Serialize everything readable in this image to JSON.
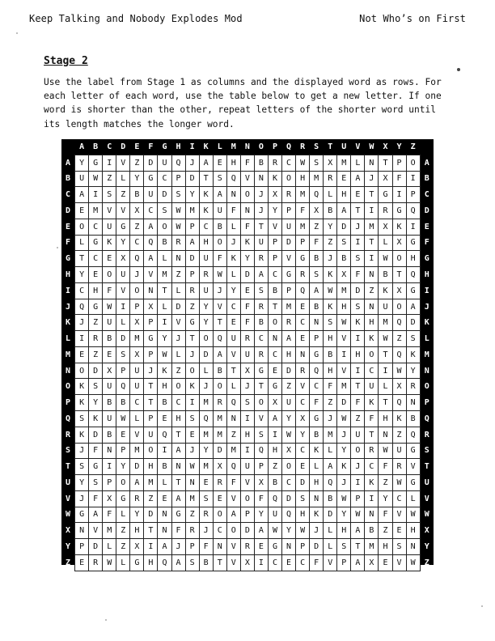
{
  "header": {
    "left": "Keep Talking and Nobody Explodes Mod",
    "right": "Not Who’s on First"
  },
  "stage_title": "Stage 2",
  "instructions": "Use the label from Stage 1 as columns and the displayed word as rows. For each letter of each word, use the table below to get a new letter. If one word is shorter than the other, repeat letters of the shorter word until its length matches the longer word.",
  "table": {
    "columns": [
      "A",
      "B",
      "C",
      "D",
      "E",
      "F",
      "G",
      "H",
      "I",
      "K",
      "L",
      "M",
      "N",
      "O",
      "P",
      "Q",
      "R",
      "S",
      "T",
      "U",
      "V",
      "W",
      "X",
      "Y",
      "Z"
    ],
    "rows": [
      {
        "label": "A",
        "cells": [
          "Y",
          "G",
          "I",
          "V",
          "Z",
          "D",
          "U",
          "Q",
          "J",
          "A",
          "E",
          "H",
          "F",
          "B",
          "R",
          "C",
          "W",
          "S",
          "X",
          "M",
          "L",
          "N",
          "T",
          "P",
          "O"
        ]
      },
      {
        "label": "B",
        "cells": [
          "U",
          "W",
          "Z",
          "L",
          "Y",
          "G",
          "C",
          "P",
          "D",
          "T",
          "S",
          "Q",
          "V",
          "N",
          "K",
          "O",
          "H",
          "M",
          "R",
          "E",
          "A",
          "J",
          "X",
          "F",
          "I"
        ]
      },
      {
        "label": "C",
        "cells": [
          "A",
          "I",
          "S",
          "Z",
          "B",
          "U",
          "D",
          "S",
          "Y",
          "K",
          "A",
          "N",
          "O",
          "J",
          "X",
          "R",
          "M",
          "Q",
          "L",
          "H",
          "E",
          "T",
          "G",
          "I",
          "P"
        ]
      },
      {
        "label": "D",
        "cells": [
          "E",
          "M",
          "V",
          "V",
          "X",
          "C",
          "S",
          "W",
          "M",
          "K",
          "U",
          "F",
          "N",
          "J",
          "Y",
          "P",
          "F",
          "X",
          "B",
          "A",
          "T",
          "I",
          "R",
          "G",
          "Q"
        ]
      },
      {
        "label": "E",
        "cells": [
          "O",
          "C",
          "U",
          "G",
          "Z",
          "A",
          "O",
          "W",
          "P",
          "C",
          "B",
          "L",
          "F",
          "T",
          "V",
          "U",
          "M",
          "Z",
          "Y",
          "D",
          "J",
          "M",
          "X",
          "K",
          "I"
        ]
      },
      {
        "label": "F",
        "cells": [
          "L",
          "G",
          "K",
          "Y",
          "C",
          "Q",
          "B",
          "R",
          "A",
          "H",
          "O",
          "J",
          "K",
          "U",
          "P",
          "D",
          "P",
          "F",
          "Z",
          "S",
          "I",
          "T",
          "L",
          "X",
          "G"
        ]
      },
      {
        "label": "G",
        "cells": [
          "T",
          "C",
          "E",
          "X",
          "Q",
          "A",
          "L",
          "N",
          "D",
          "U",
          "F",
          "K",
          "Y",
          "R",
          "P",
          "V",
          "G",
          "B",
          "J",
          "B",
          "S",
          "I",
          "W",
          "O",
          "H"
        ]
      },
      {
        "label": "H",
        "cells": [
          "Y",
          "E",
          "O",
          "U",
          "J",
          "V",
          "M",
          "Z",
          "P",
          "R",
          "W",
          "L",
          "D",
          "A",
          "C",
          "G",
          "R",
          "S",
          "K",
          "X",
          "F",
          "N",
          "B",
          "T",
          "Q"
        ]
      },
      {
        "label": "I",
        "cells": [
          "C",
          "H",
          "F",
          "V",
          "O",
          "N",
          "T",
          "L",
          "R",
          "U",
          "J",
          "Y",
          "E",
          "S",
          "B",
          "P",
          "Q",
          "A",
          "W",
          "M",
          "D",
          "Z",
          "K",
          "X",
          "G"
        ]
      },
      {
        "label": "J",
        "cells": [
          "Q",
          "G",
          "W",
          "I",
          "P",
          "X",
          "L",
          "D",
          "Z",
          "Y",
          "V",
          "C",
          "F",
          "R",
          "T",
          "M",
          "E",
          "B",
          "K",
          "H",
          "S",
          "N",
          "U",
          "O",
          "A"
        ]
      },
      {
        "label": "K",
        "cells": [
          "J",
          "Z",
          "U",
          "L",
          "X",
          "P",
          "I",
          "V",
          "G",
          "Y",
          "T",
          "E",
          "F",
          "B",
          "O",
          "R",
          "C",
          "N",
          "S",
          "W",
          "K",
          "H",
          "M",
          "Q",
          "D"
        ]
      },
      {
        "label": "L",
        "cells": [
          "I",
          "R",
          "B",
          "D",
          "M",
          "G",
          "Y",
          "J",
          "T",
          "O",
          "Q",
          "U",
          "R",
          "C",
          "N",
          "A",
          "E",
          "P",
          "H",
          "V",
          "I",
          "K",
          "W",
          "Z",
          "S"
        ]
      },
      {
        "label": "M",
        "cells": [
          "E",
          "Z",
          "E",
          "S",
          "X",
          "P",
          "W",
          "L",
          "J",
          "D",
          "A",
          "V",
          "U",
          "R",
          "C",
          "H",
          "N",
          "G",
          "B",
          "I",
          "H",
          "O",
          "T",
          "Q",
          "K"
        ]
      },
      {
        "label": "N",
        "cells": [
          "O",
          "D",
          "X",
          "P",
          "U",
          "J",
          "K",
          "Z",
          "O",
          "L",
          "B",
          "T",
          "X",
          "G",
          "E",
          "D",
          "R",
          "Q",
          "H",
          "V",
          "I",
          "C",
          "I",
          "W",
          "Y"
        ]
      },
      {
        "label": "O",
        "cells": [
          "K",
          "S",
          "U",
          "Q",
          "U",
          "T",
          "H",
          "O",
          "K",
          "J",
          "O",
          "L",
          "J",
          "T",
          "G",
          "Z",
          "V",
          "C",
          "F",
          "M",
          "T",
          "U",
          "L",
          "X",
          "R"
        ]
      },
      {
        "label": "P",
        "cells": [
          "K",
          "Y",
          "B",
          "B",
          "C",
          "T",
          "B",
          "C",
          "I",
          "M",
          "R",
          "Q",
          "S",
          "O",
          "X",
          "U",
          "C",
          "F",
          "Z",
          "D",
          "F",
          "K",
          "T",
          "Q",
          "N"
        ]
      },
      {
        "label": "Q",
        "cells": [
          "S",
          "K",
          "U",
          "W",
          "L",
          "P",
          "E",
          "H",
          "S",
          "Q",
          "M",
          "N",
          "I",
          "V",
          "A",
          "Y",
          "X",
          "G",
          "J",
          "W",
          "Z",
          "F",
          "H",
          "K",
          "B"
        ]
      },
      {
        "label": "R",
        "cells": [
          "K",
          "D",
          "B",
          "E",
          "V",
          "U",
          "Q",
          "T",
          "E",
          "M",
          "M",
          "Z",
          "H",
          "S",
          "I",
          "W",
          "Y",
          "B",
          "M",
          "J",
          "U",
          "T",
          "N",
          "Z",
          "Q"
        ]
      },
      {
        "label": "S",
        "cells": [
          "J",
          "F",
          "N",
          "P",
          "M",
          "O",
          "I",
          "A",
          "J",
          "Y",
          "D",
          "M",
          "I",
          "Q",
          "H",
          "X",
          "C",
          "K",
          "L",
          "Y",
          "O",
          "R",
          "W",
          "U",
          "G"
        ]
      },
      {
        "label": "T",
        "cells": [
          "S",
          "G",
          "I",
          "Y",
          "D",
          "H",
          "B",
          "N",
          "W",
          "M",
          "X",
          "Q",
          "U",
          "P",
          "Z",
          "O",
          "E",
          "L",
          "A",
          "K",
          "J",
          "C",
          "F",
          "R",
          "V"
        ]
      },
      {
        "label": "U",
        "cells": [
          "Y",
          "S",
          "P",
          "O",
          "A",
          "M",
          "L",
          "T",
          "N",
          "E",
          "R",
          "F",
          "V",
          "X",
          "B",
          "C",
          "D",
          "H",
          "Q",
          "J",
          "I",
          "K",
          "Z",
          "W",
          "G"
        ]
      },
      {
        "label": "V",
        "cells": [
          "J",
          "F",
          "X",
          "G",
          "R",
          "Z",
          "E",
          "A",
          "M",
          "S",
          "E",
          "V",
          "O",
          "F",
          "Q",
          "D",
          "S",
          "N",
          "B",
          "W",
          "P",
          "I",
          "Y",
          "C",
          "L"
        ]
      },
      {
        "label": "W",
        "cells": [
          "G",
          "A",
          "F",
          "L",
          "Y",
          "D",
          "N",
          "G",
          "Z",
          "R",
          "O",
          "A",
          "P",
          "Y",
          "U",
          "Q",
          "H",
          "K",
          "D",
          "Y",
          "W",
          "N",
          "F",
          "V",
          "W"
        ]
      },
      {
        "label": "X",
        "cells": [
          "N",
          "V",
          "M",
          "Z",
          "H",
          "T",
          "N",
          "F",
          "R",
          "J",
          "C",
          "O",
          "D",
          "A",
          "W",
          "Y",
          "W",
          "J",
          "L",
          "H",
          "A",
          "B",
          "Z",
          "E",
          "H"
        ]
      },
      {
        "label": "Y",
        "cells": [
          "P",
          "D",
          "L",
          "Z",
          "X",
          "I",
          "A",
          "J",
          "P",
          "F",
          "N",
          "V",
          "R",
          "E",
          "G",
          "N",
          "P",
          "D",
          "L",
          "S",
          "T",
          "M",
          "H",
          "S",
          "N"
        ]
      },
      {
        "label": "Z",
        "cells": [
          "E",
          "R",
          "W",
          "L",
          "G",
          "H",
          "Q",
          "A",
          "S",
          "B",
          "T",
          "V",
          "X",
          "I",
          "C",
          "E",
          "C",
          "F",
          "V",
          "P",
          "A",
          "X",
          "E",
          "V",
          "W"
        ]
      }
    ]
  }
}
